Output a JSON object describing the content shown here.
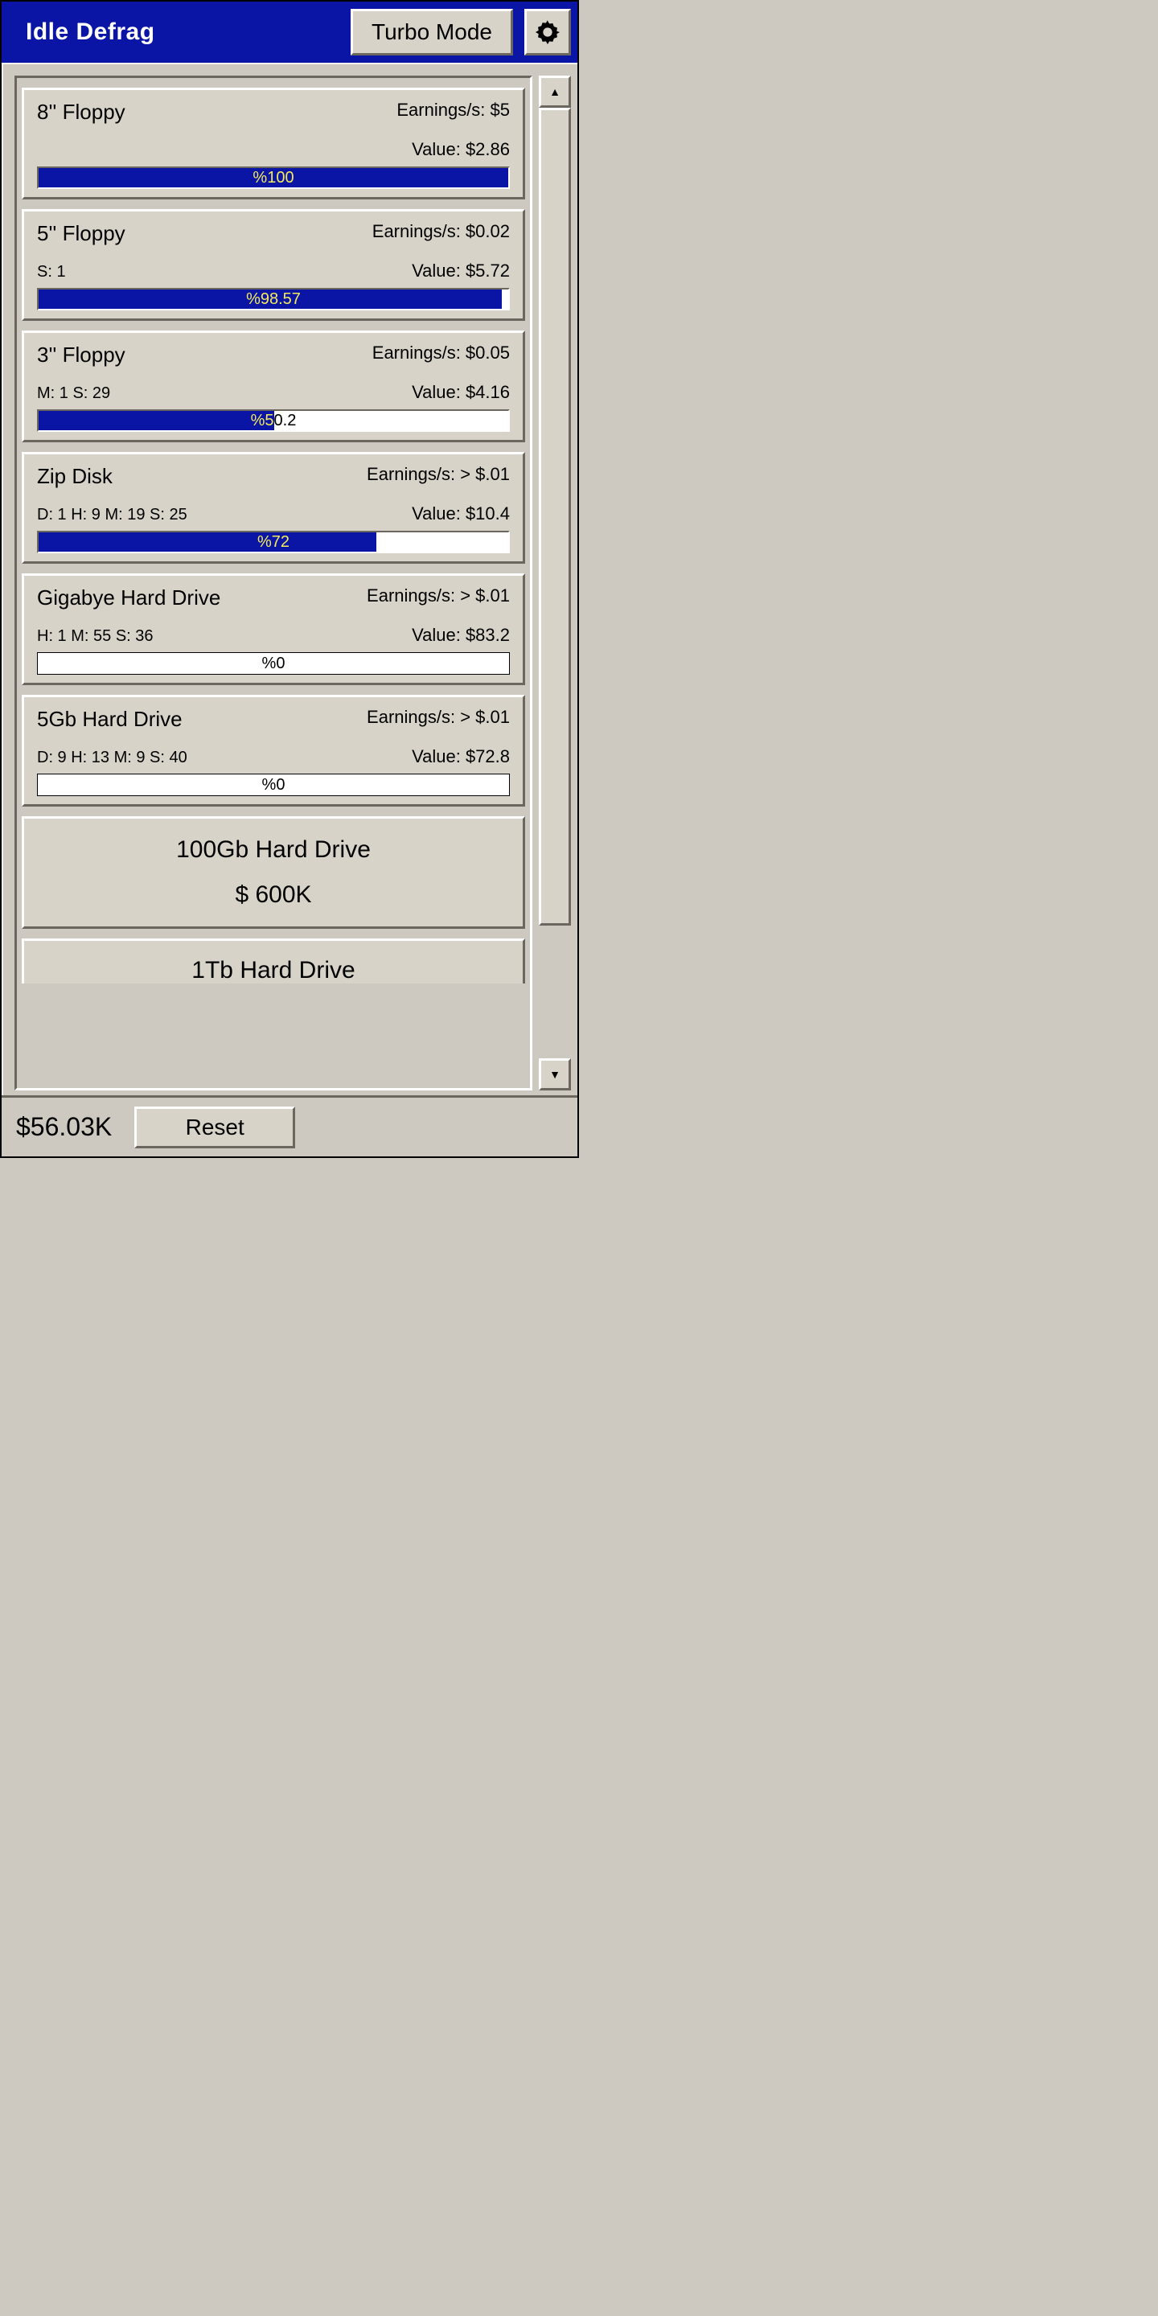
{
  "header": {
    "title": "Idle Defrag",
    "turbo_label": "Turbo Mode"
  },
  "cards": [
    {
      "name": "8'' Floppy",
      "time": "",
      "earnings": "Earnings/s: $5",
      "value": "Value: $2.86",
      "percent": 100,
      "percent_label": "%100"
    },
    {
      "name": "5'' Floppy",
      "time": "S: 1",
      "earnings": "Earnings/s: $0.02",
      "value": "Value: $5.72",
      "percent": 98.57,
      "percent_label": "%98.57"
    },
    {
      "name": "3'' Floppy",
      "time": "M: 1 S: 29",
      "earnings": "Earnings/s: $0.05",
      "value": "Value: $4.16",
      "percent": 50.2,
      "percent_label": "%50.2"
    },
    {
      "name": "Zip Disk",
      "time": "D: 1 H: 9 M: 19 S: 25",
      "earnings": "Earnings/s: > $.01",
      "value": "Value: $10.4",
      "percent": 72,
      "percent_label": "%72"
    },
    {
      "name": "Gigabye Hard Drive",
      "time": "H: 1 M: 55 S: 36",
      "earnings": "Earnings/s: > $.01",
      "value": "Value: $83.2",
      "percent": 0,
      "percent_label": "%0"
    },
    {
      "name": "5Gb Hard Drive",
      "time": "D: 9 H: 13 M: 9 S: 40",
      "earnings": "Earnings/s: > $.01",
      "value": "Value: $72.8",
      "percent": 0,
      "percent_label": "%0"
    }
  ],
  "locked": [
    {
      "name": "100Gb Hard Drive",
      "cost": "$ 600K"
    },
    {
      "name": "1Tb Hard Drive"
    }
  ],
  "footer": {
    "balance": "$56.03K",
    "reset_label": "Reset"
  }
}
